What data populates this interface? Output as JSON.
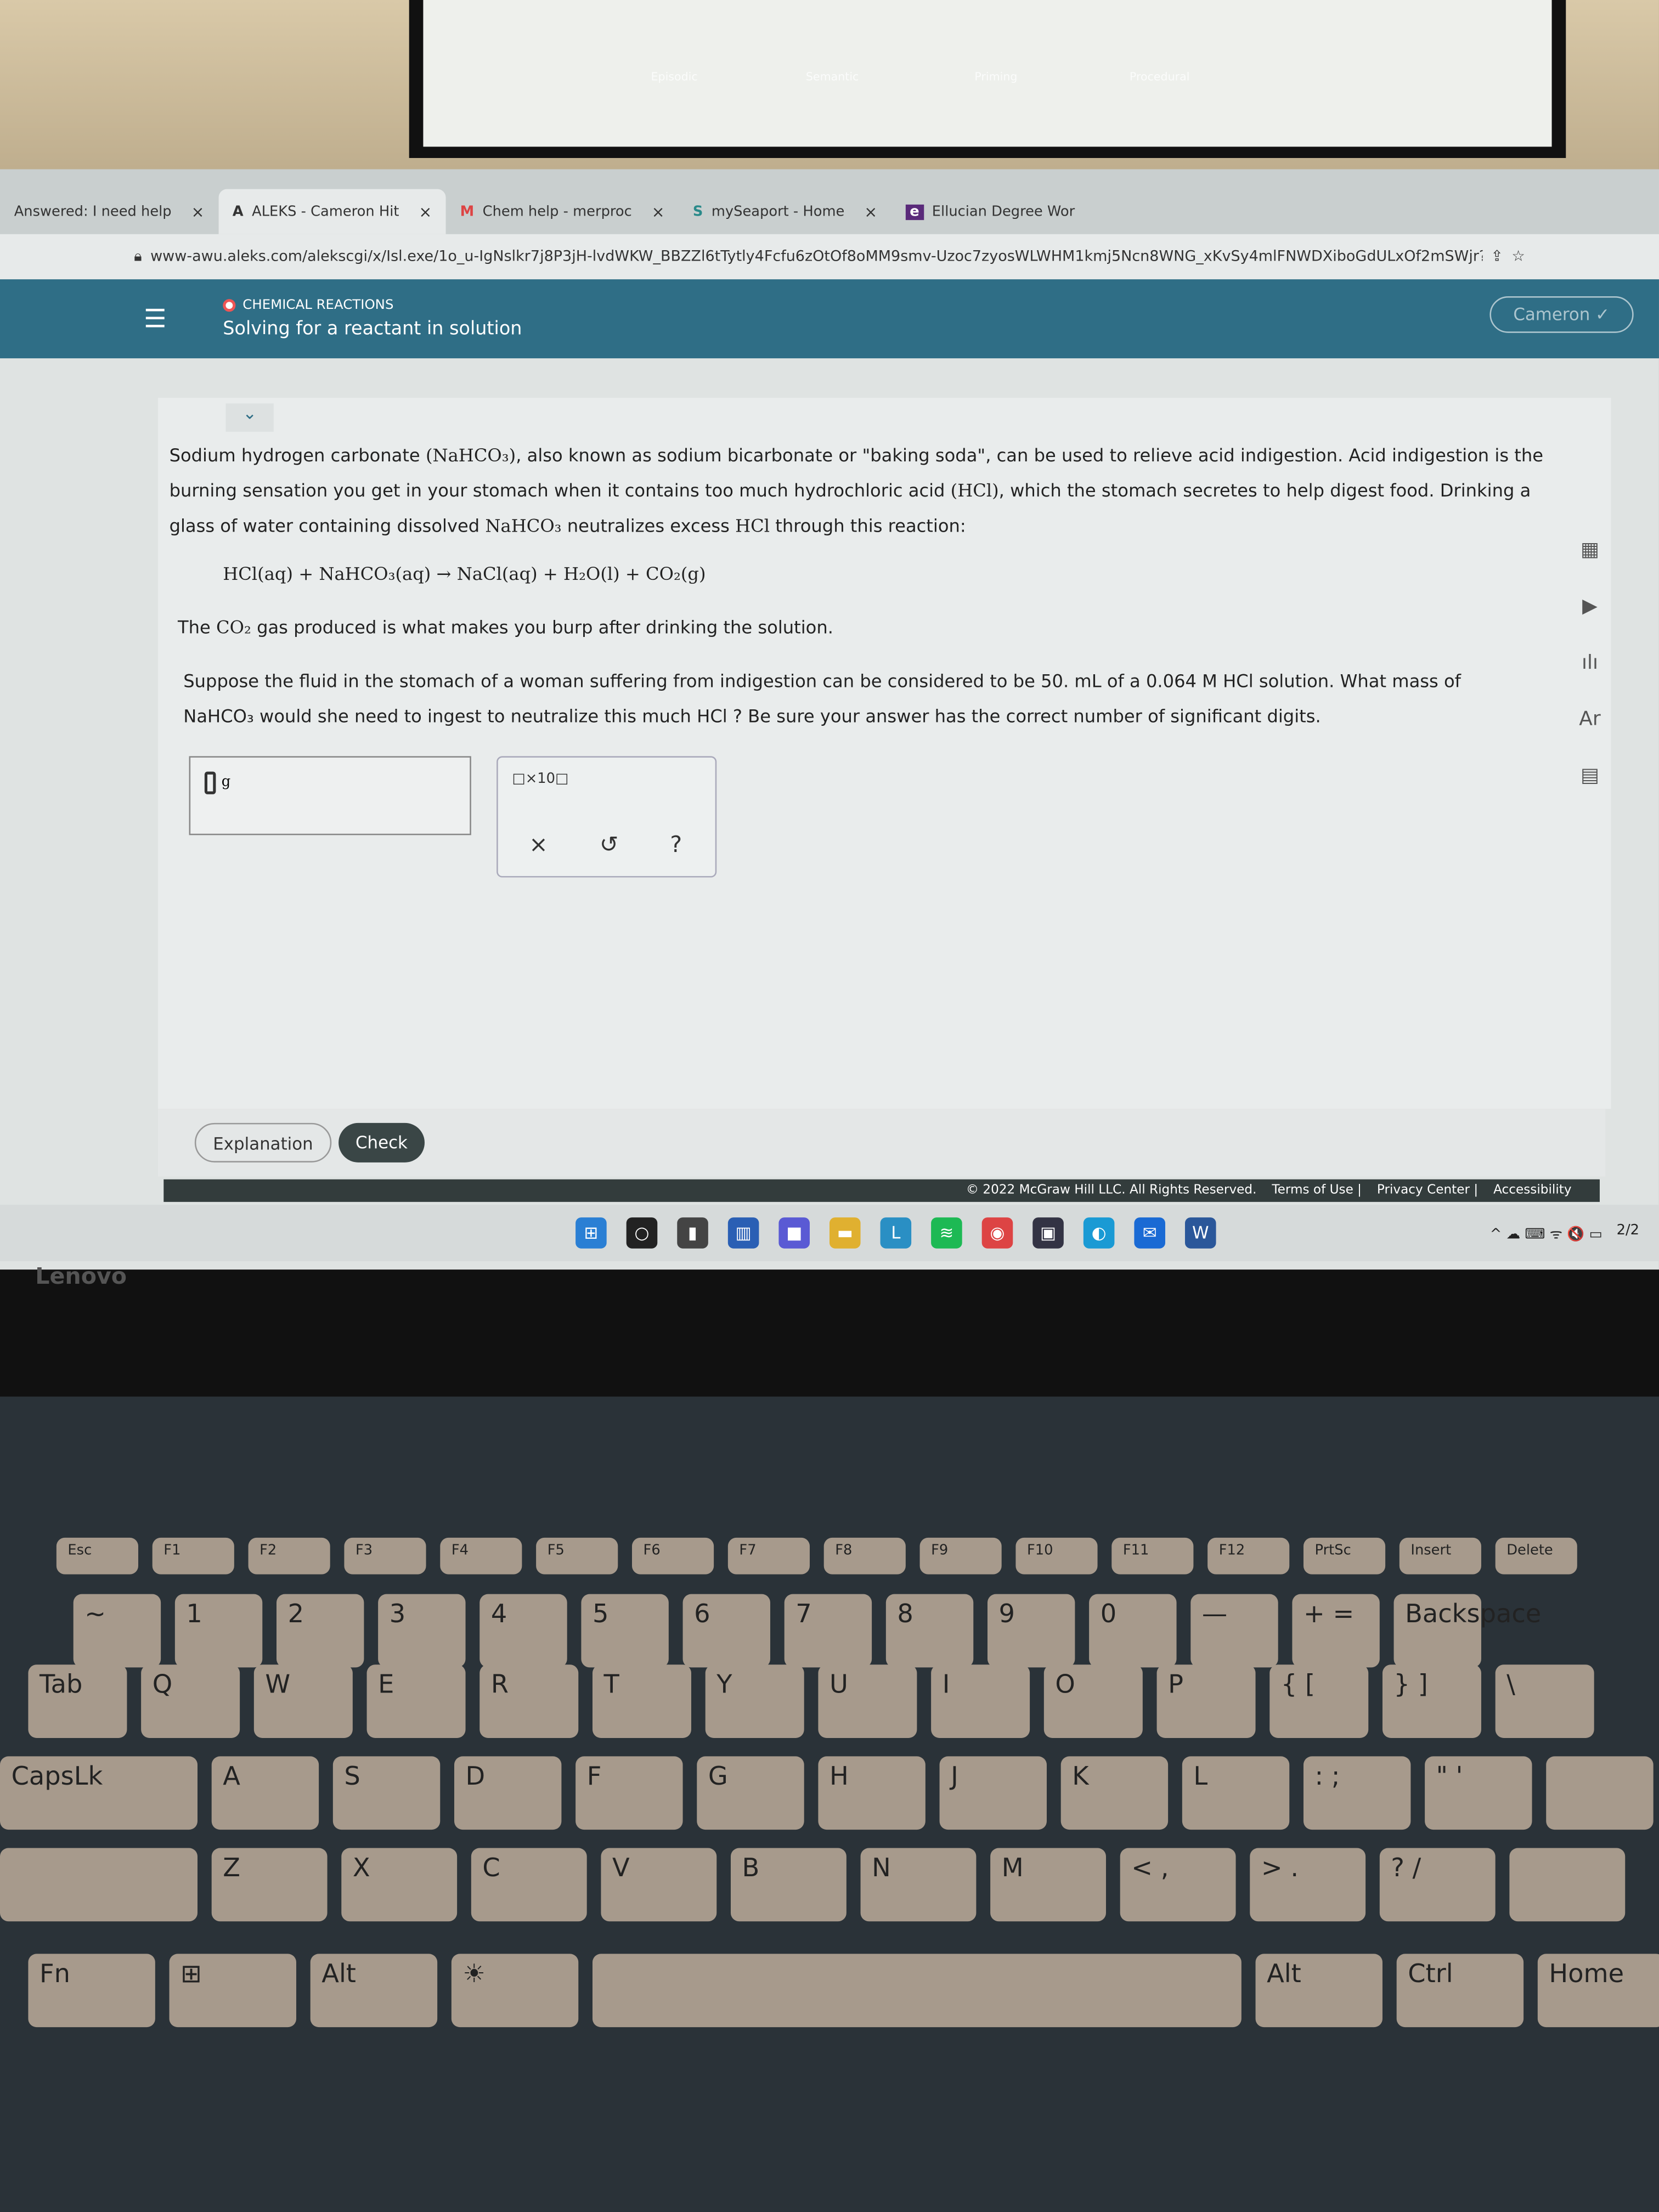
{
  "monitor": {
    "boxes": [
      {
        "label": "Episodic",
        "color": "#e8c94a"
      },
      {
        "label": "Semantic",
        "color": "#c9b94a"
      },
      {
        "label": "Priming",
        "color": "#a9c9d0"
      },
      {
        "label": "Procedural",
        "color": "#b0a8b8"
      }
    ]
  },
  "browser": {
    "tabs": [
      {
        "label": "Answered: I need help",
        "active": false
      },
      {
        "label": "ALEKS - Cameron Hit",
        "active": true,
        "icon": "A"
      },
      {
        "label": "Chem help - merproc",
        "active": false,
        "icon": "M"
      },
      {
        "label": "mySeaport - Home",
        "active": false,
        "icon": "S"
      },
      {
        "label": "Ellucian Degree Wor",
        "active": false,
        "icon": "e"
      }
    ],
    "close": "×",
    "url": "www-awu.aleks.com/alekscgi/x/Isl.exe/1o_u-IgNslkr7j8P3jH-lvdWKW_BBZZl6tTytly4Fcfu6zOtOf8oMM9smv-Uzoc7zyosWLWHM1kmj5Ncn8WNG_xKvSy4mlFNWDXiboGdULxOf2mSWjr?1oBw7..."
  },
  "header": {
    "menu": "☰",
    "category": "CHEMICAL REACTIONS",
    "title": "Solving for a reactant in solution",
    "user": "Cameron ✓",
    "collapse": "⌄"
  },
  "question": {
    "p1a": "Sodium hydrogen carbonate ",
    "p1chem": "(NaHCO₃)",
    "p1b": ", also known as sodium bicarbonate or \"baking soda\", can be used to relieve acid indigestion. Acid indigestion is the burning sensation you get in your stomach when it contains too much hydrochloric acid ",
    "p1hcl": "(HCl)",
    "p1c": ", which the stomach secretes to help digest food. Drinking a glass of water containing dissolved ",
    "p1chem2": "NaHCO₃",
    "p1d": " neutralizes excess ",
    "p1hcl2": "HCl",
    "p1e": " through this reaction:",
    "reaction": "HCl(aq) + NaHCO₃(aq) → NaCl(aq) + H₂O(l) + CO₂(g)",
    "p2a": "The ",
    "p2chem": "CO₂",
    "p2b": " gas produced is what makes you burp after drinking the solution.",
    "p3": "Suppose the fluid in the stomach of a woman suffering from indigestion can be considered to be 50. mL of a 0.064 M HCl solution. What mass of NaHCO₃ would she need to ingest to neutralize this much HCl ? Be sure your answer has the correct number of significant digits."
  },
  "answer": {
    "value": "",
    "unit": "g"
  },
  "tools": {
    "x10": "□×10□",
    "clear": "×",
    "undo": "↺",
    "help": "?"
  },
  "side_tools": [
    "▦",
    "▶",
    "ılı",
    "Ar",
    "▤"
  ],
  "buttons": {
    "explanation": "Explanation",
    "check": "Check"
  },
  "footer": {
    "copyright": "© 2022 McGraw Hill LLC. All Rights Reserved.",
    "terms": "Terms of Use",
    "privacy": "Privacy Center",
    "accessibility": "Accessibility"
  },
  "taskbar": {
    "icons": [
      {
        "name": "windows",
        "glyph": "⊞",
        "color": "#2a7fd4"
      },
      {
        "name": "search",
        "glyph": "○",
        "color": "#222"
      },
      {
        "name": "task-view",
        "glyph": "▮",
        "color": "#444"
      },
      {
        "name": "widgets",
        "glyph": "▥",
        "color": "#2a5fb4"
      },
      {
        "name": "teams",
        "glyph": "■",
        "color": "#5a5ad4"
      },
      {
        "name": "file-explorer",
        "glyph": "▬",
        "color": "#e0b030"
      },
      {
        "name": "l-app",
        "glyph": "L",
        "color": "#2a8fc4"
      },
      {
        "name": "spotify",
        "glyph": "≋",
        "color": "#1db954"
      },
      {
        "name": "chrome",
        "glyph": "◉",
        "color": "#d44"
      },
      {
        "name": "store",
        "glyph": "▣",
        "color": "#334"
      },
      {
        "name": "edge",
        "glyph": "◐",
        "color": "#1a9ad4"
      },
      {
        "name": "mail",
        "glyph": "✉",
        "color": "#1a6ad4"
      },
      {
        "name": "word",
        "glyph": "W",
        "color": "#2b579a"
      }
    ],
    "tray": "^  ☁  ⌨  ᯤ  🔇  ▭",
    "date": "2/2"
  },
  "laptop": {
    "brand": "Lenovo"
  },
  "keyboard": {
    "frow": [
      "Esc",
      "F1",
      "F2",
      "F3",
      "F4",
      "F5",
      "F6",
      "F7",
      "F8",
      "F9",
      "F10",
      "F11",
      "F12",
      "PrtSc",
      "Insert",
      "Delete"
    ],
    "num": [
      "~",
      "1",
      "2",
      "3",
      "4",
      "5",
      "6",
      "7",
      "8",
      "9",
      "0",
      "—",
      "+ =",
      "Backspace"
    ],
    "top": [
      "Tab",
      "Q",
      "W",
      "E",
      "R",
      "T",
      "Y",
      "U",
      "I",
      "O",
      "P",
      "{ [",
      "} ]",
      "\\"
    ],
    "home": [
      "CapsLk",
      "A",
      "S",
      "D",
      "F",
      "G",
      "H",
      "J",
      "K",
      "L",
      ": ;",
      "\" '",
      ""
    ],
    "bottom": [
      "",
      "Z",
      "X",
      "C",
      "V",
      "B",
      "N",
      "M",
      "< ,",
      "> .",
      "? /",
      ""
    ],
    "space": [
      "Fn",
      "⊞",
      "Alt",
      "☀",
      "",
      "Alt",
      "Ctrl",
      "Home"
    ]
  }
}
